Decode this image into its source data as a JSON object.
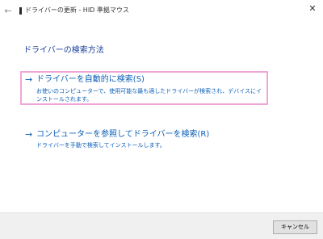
{
  "window": {
    "title": "ドライバーの更新 - HID 準拠マウス",
    "back_icon": "←",
    "close_icon": "✕"
  },
  "main": {
    "heading": "ドライバーの検索方法",
    "options": [
      {
        "arrow": "→",
        "title": "ドライバーを自動的に検索(S)",
        "description": "お使いのコンピューターで、使用可能な最も適したドライバーが検索され、デバイスにインストールされます。"
      },
      {
        "arrow": "→",
        "title": "コンピューターを参照してドライバーを検索(R)",
        "description": "ドライバーを手動で検索してインストールします。"
      }
    ]
  },
  "footer": {
    "cancel_label": "キャンセル"
  },
  "colors": {
    "accent": "#0c5fb8",
    "heading": "#1b3f99",
    "focus_border": "#f0a6d6",
    "footer_bg": "#f0f0f0"
  }
}
